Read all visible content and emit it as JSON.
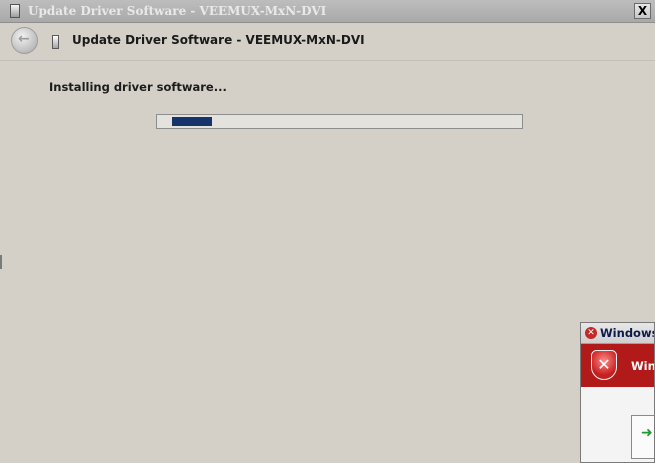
{
  "window": {
    "title": "Update Driver Software - VEEMUX-MxN-DVI",
    "close_label": "X"
  },
  "nav": {
    "back_glyph": "←",
    "heading": "Update Driver Software - VEEMUX-MxN-DVI"
  },
  "main": {
    "status_text": "Installing driver software...",
    "progress_fraction": 0.11
  },
  "security_dialog": {
    "title": "Windows",
    "banner_text": "Win",
    "option_glyph": "➜"
  },
  "colors": {
    "progress_fill": "#14346b",
    "security_banner": "#b21a1a"
  }
}
